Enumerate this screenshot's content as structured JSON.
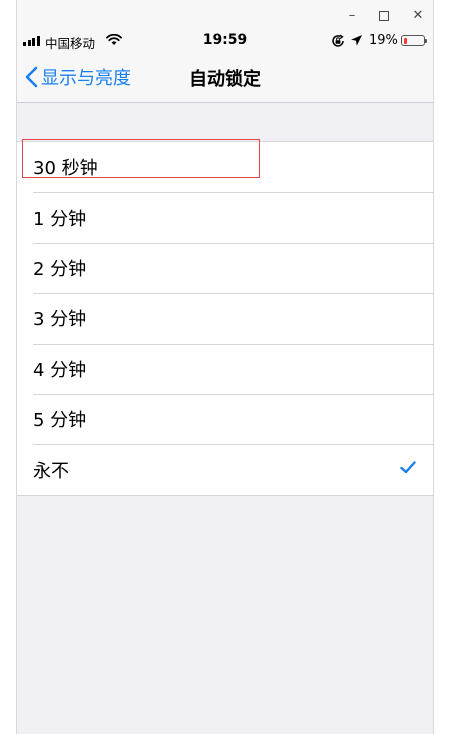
{
  "window_controls": {
    "minimize": "–",
    "close": "✕"
  },
  "status_bar": {
    "carrier": "中国移动",
    "time": "19:59",
    "battery_percent": "19%",
    "battery_level": 0.19,
    "battery_color": "#ff3b30",
    "icons": [
      "signal-icon",
      "wifi-icon",
      "rotation-lock-icon",
      "location-icon",
      "battery-icon"
    ]
  },
  "nav": {
    "back_label": "显示与亮度",
    "title": "自动锁定",
    "accent": "#1a7ff0"
  },
  "options": [
    {
      "label": "30 秒钟",
      "selected": false
    },
    {
      "label": "1 分钟",
      "selected": false
    },
    {
      "label": "2 分钟",
      "selected": false
    },
    {
      "label": "3 分钟",
      "selected": false
    },
    {
      "label": "4 分钟",
      "selected": false
    },
    {
      "label": "5 分钟",
      "selected": false
    },
    {
      "label": "永不",
      "selected": true
    }
  ],
  "annotation": {
    "color": "#e0474c"
  }
}
